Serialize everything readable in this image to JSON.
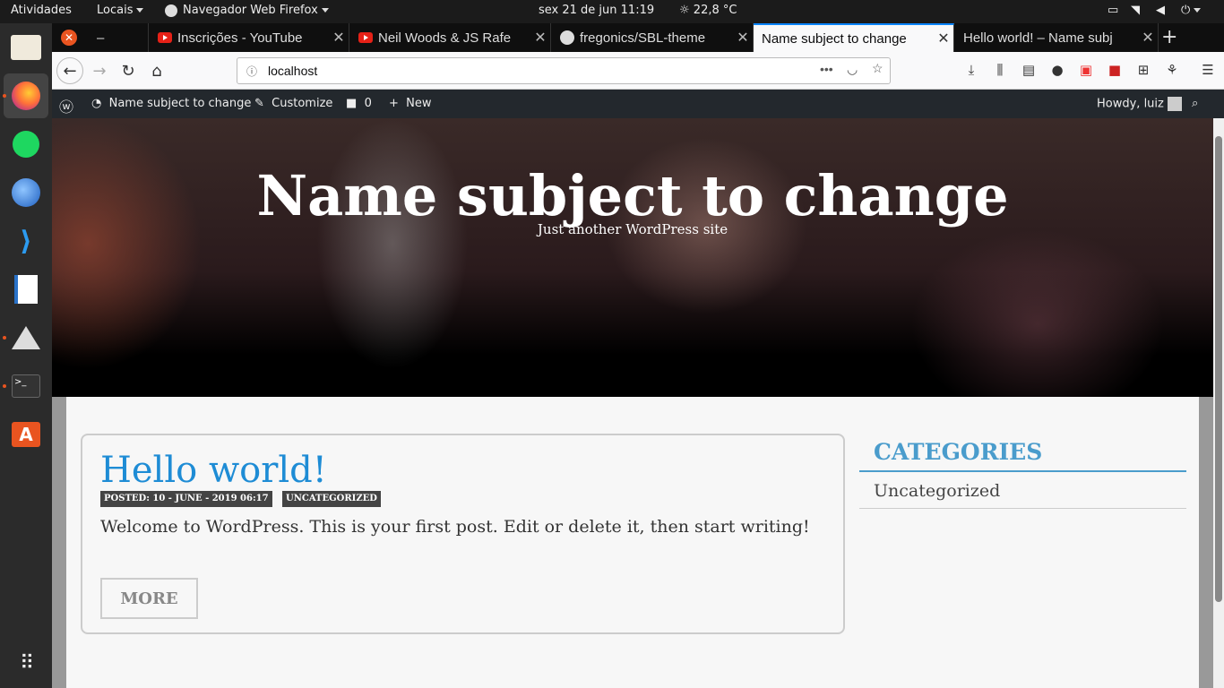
{
  "topbar": {
    "activities": "Atividades",
    "places": "Locais",
    "app_menu": "Navegador Web Firefox",
    "clock": "sex 21 de jun  11:19",
    "weather": "22,8 °C"
  },
  "dock": {
    "items": [
      "files-icon",
      "firefox-icon",
      "spotify-icon",
      "thunderbird-icon",
      "vscode-icon",
      "writer-icon",
      "inkscape-icon",
      "terminal-icon",
      "software-icon",
      "app-grid-icon"
    ]
  },
  "tabs": [
    {
      "label": "–"
    },
    {
      "label": "Inscrições - YouTube"
    },
    {
      "label": "Neil Woods & JS Rafe"
    },
    {
      "label": "fregonics/SBL-theme"
    },
    {
      "label": "Name subject to change"
    },
    {
      "label": "Hello world! – Name subj"
    }
  ],
  "navbar": {
    "url": "localhost"
  },
  "wpbar": {
    "site_name": "Name subject to change",
    "customize": "Customize",
    "comments": "0",
    "new": "New",
    "howdy": "Howdy, luiz"
  },
  "site": {
    "title": "Name subject to change",
    "description": "Just another WordPress site"
  },
  "post": {
    "title": "Hello world!",
    "posted": "POSTED: 10 - JUNE - 2019 06:17",
    "category": "UNCATEGORIZED",
    "excerpt": "Welcome to WordPress. This is your first post. Edit or delete it, then start writing!",
    "more": "MORE"
  },
  "sidebar": {
    "title": "CATEGORIES",
    "items": [
      "Uncategorized"
    ]
  }
}
